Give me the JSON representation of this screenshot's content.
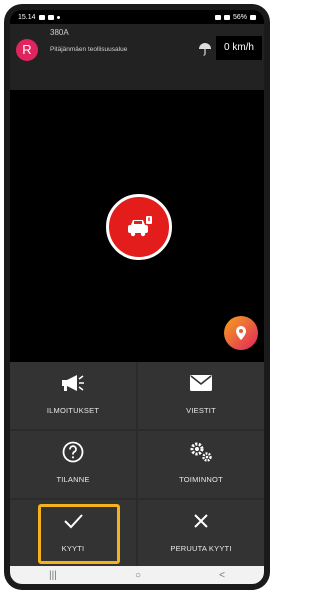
{
  "status": {
    "time": "15.14",
    "battery": "56%"
  },
  "header": {
    "avatar_letter": "R",
    "route_number": "380A",
    "route_name": "Pitäjänmäen teollisuusalue",
    "speed": "0",
    "speed_unit": "km/h"
  },
  "map": {
    "center_button_icon": "car-alert-icon",
    "location_button_icon": "location-pin-icon"
  },
  "actions": {
    "ilmoitukset": "ILMOITUKSET",
    "viestit": "VIESTIT",
    "tilanne": "TILANNE",
    "toiminnot": "TOIMINNOT",
    "kyyti": "KYYTI",
    "peruuta": "PERUUTA KYYTI"
  },
  "nav": {
    "recent": "|||",
    "home": "○",
    "back": "<"
  },
  "colors": {
    "accent": "#e31c1c",
    "avatar": "#e0245e",
    "highlight": "#f4b31c"
  }
}
